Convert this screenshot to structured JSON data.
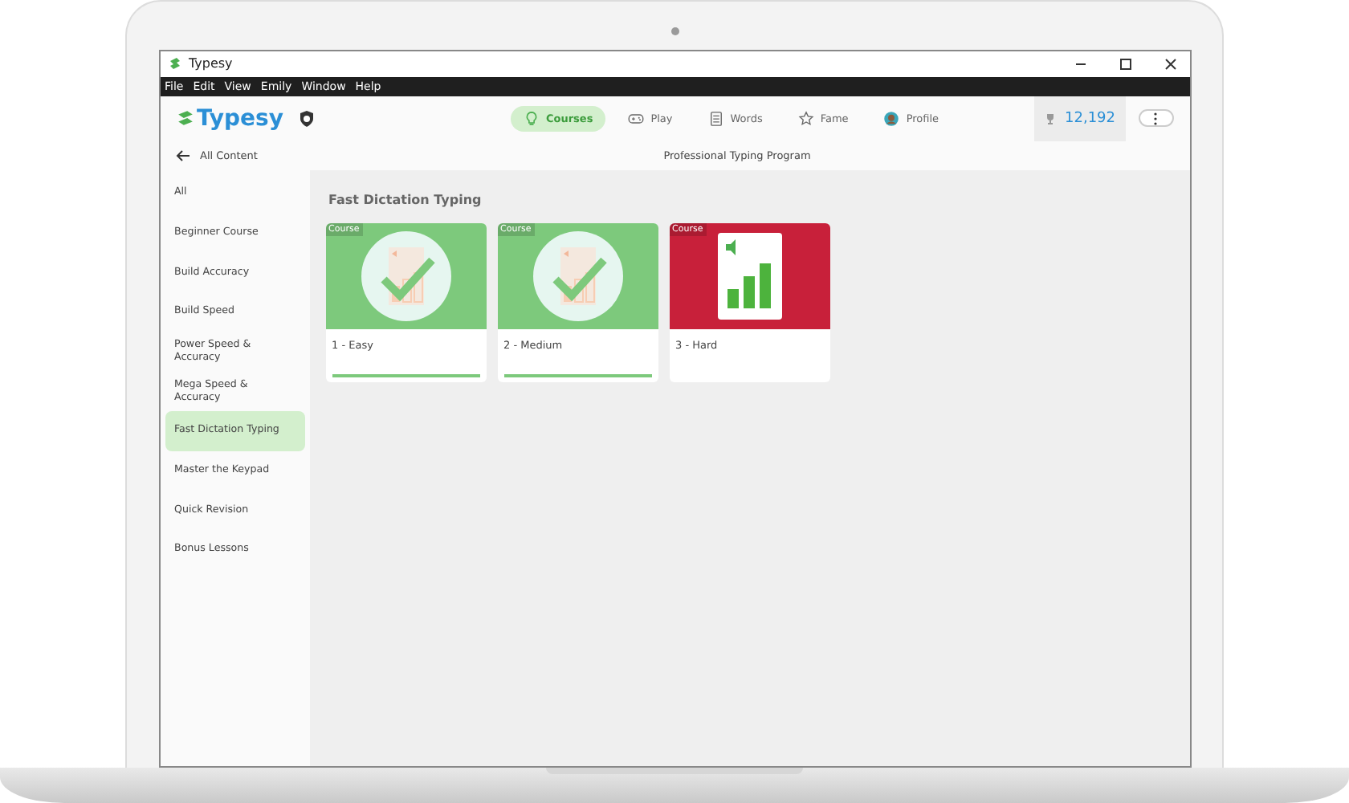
{
  "window": {
    "title": "Typesy"
  },
  "menu_bar": [
    "File",
    "Edit",
    "View",
    "Emily",
    "Window",
    "Help"
  ],
  "header": {
    "logo": "Typesy",
    "nav": [
      {
        "label": "Courses",
        "kind": "courses",
        "selected": true
      },
      {
        "label": "Play",
        "kind": "play",
        "selected": false
      },
      {
        "label": "Words",
        "kind": "words",
        "selected": false
      },
      {
        "label": "Fame",
        "kind": "fame",
        "selected": false
      },
      {
        "label": "Profile",
        "kind": "profile",
        "selected": false
      }
    ],
    "points": "12,192"
  },
  "back_link": "All Content",
  "page_title": "Professional Typing Program",
  "sidebar": {
    "items": [
      {
        "label": "All",
        "selected": false
      },
      {
        "label": "Beginner Course",
        "selected": false
      },
      {
        "label": "Build Accuracy",
        "selected": false
      },
      {
        "label": "Build Speed",
        "selected": false
      },
      {
        "label": "Power Speed & Accuracy",
        "selected": false
      },
      {
        "label": "Mega Speed & Accuracy",
        "selected": false
      },
      {
        "label": "Fast Dictation Typing",
        "selected": true
      },
      {
        "label": "Master the Keypad",
        "selected": false
      },
      {
        "label": "Quick Revision",
        "selected": false
      },
      {
        "label": "Bonus Lessons",
        "selected": false
      }
    ]
  },
  "section": {
    "title": "Fast Dictation Typing",
    "cards": [
      {
        "tag": "Course",
        "title": "1 - Easy",
        "color": "#7dc97c",
        "completed": true,
        "level": 1
      },
      {
        "tag": "Course",
        "title": "2 - Medium",
        "color": "#7dc97c",
        "completed": true,
        "level": 1
      },
      {
        "tag": "Course",
        "title": "3 - Hard",
        "color": "#c8203a",
        "completed": false
      }
    ]
  }
}
